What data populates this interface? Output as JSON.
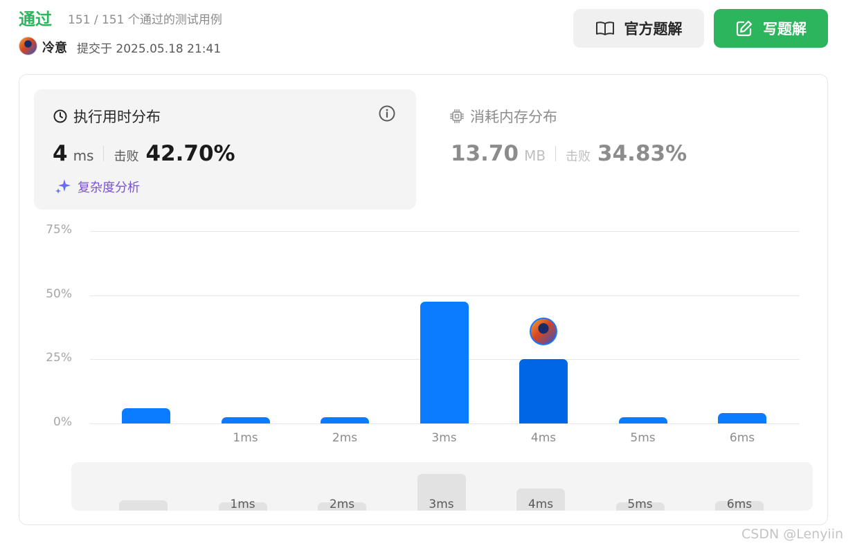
{
  "header": {
    "status": "通过",
    "cases": "151 / 151 个通过的测试用例",
    "username": "冷意",
    "submitted": "提交于 2025.05.18 21:41"
  },
  "buttons": {
    "official_solution": "官方题解",
    "write_solution": "写题解"
  },
  "runtime": {
    "title": "执行用时分布",
    "value": "4",
    "unit": "ms",
    "beat_label": "击败",
    "beat_value": "42.70%",
    "complexity_link": "复杂度分析"
  },
  "memory": {
    "title": "消耗内存分布",
    "value": "13.70",
    "unit": "MB",
    "beat_label": "击败",
    "beat_value": "34.83%"
  },
  "colors": {
    "accent_green": "#2db55d",
    "bar_blue": "#0a7cff",
    "bar_highlight": "#0066e6",
    "complexity_purple": "#7a52d6"
  },
  "chart_data": {
    "type": "bar",
    "categories": [
      "",
      "1ms",
      "2ms",
      "3ms",
      "4ms",
      "5ms",
      "6ms"
    ],
    "values": [
      6,
      2.5,
      2.5,
      47.5,
      25,
      2.5,
      4
    ],
    "highlight_category": "4ms",
    "ytick_labels": [
      "0%",
      "25%",
      "50%",
      "75%"
    ],
    "ylim": [
      0,
      75
    ],
    "grid": true
  },
  "watermark": "CSDN @Lenyiin"
}
